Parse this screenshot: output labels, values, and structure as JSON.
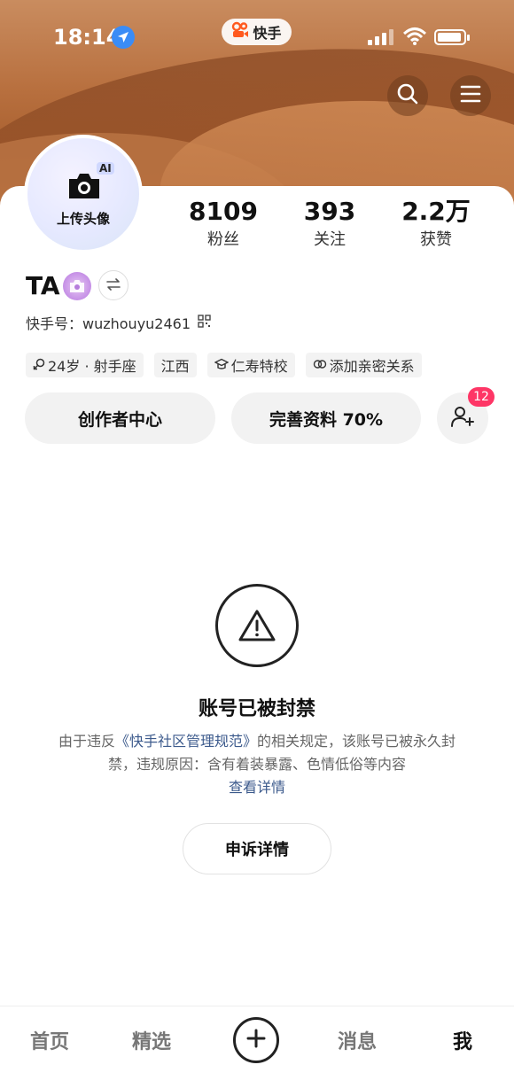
{
  "status_bar": {
    "time": "18:14",
    "app_pill": "快手"
  },
  "profile": {
    "avatar_label": "上传头像",
    "ai_tag": "AI",
    "stats": [
      {
        "value": "8109",
        "label": "粉丝"
      },
      {
        "value": "393",
        "label": "关注"
      },
      {
        "value": "2.2万",
        "label": "获赞"
      }
    ],
    "name": "TA",
    "kuaishou_id": "快手号：wuzhouyu2461",
    "tags": [
      "24岁 · 射手座",
      "江西",
      "仁寿特校",
      "添加亲密关系"
    ]
  },
  "actions": {
    "creator_center": "创作者中心",
    "complete_profile": "完善资料 70%",
    "friend_badge_count": "12"
  },
  "ban_notice": {
    "title": "账号已被封禁",
    "desc_prefix": "由于违反",
    "desc_link": "《快手社区管理规范》",
    "desc_suffix": "的相关规定，该账号已被永久封禁，违规原因：含有着装暴露、色情低俗等内容",
    "details_link": "查看详情",
    "appeal_button": "申诉详情"
  },
  "tabbar": {
    "home": "首页",
    "featured": "精选",
    "messages": "消息",
    "me": "我"
  }
}
